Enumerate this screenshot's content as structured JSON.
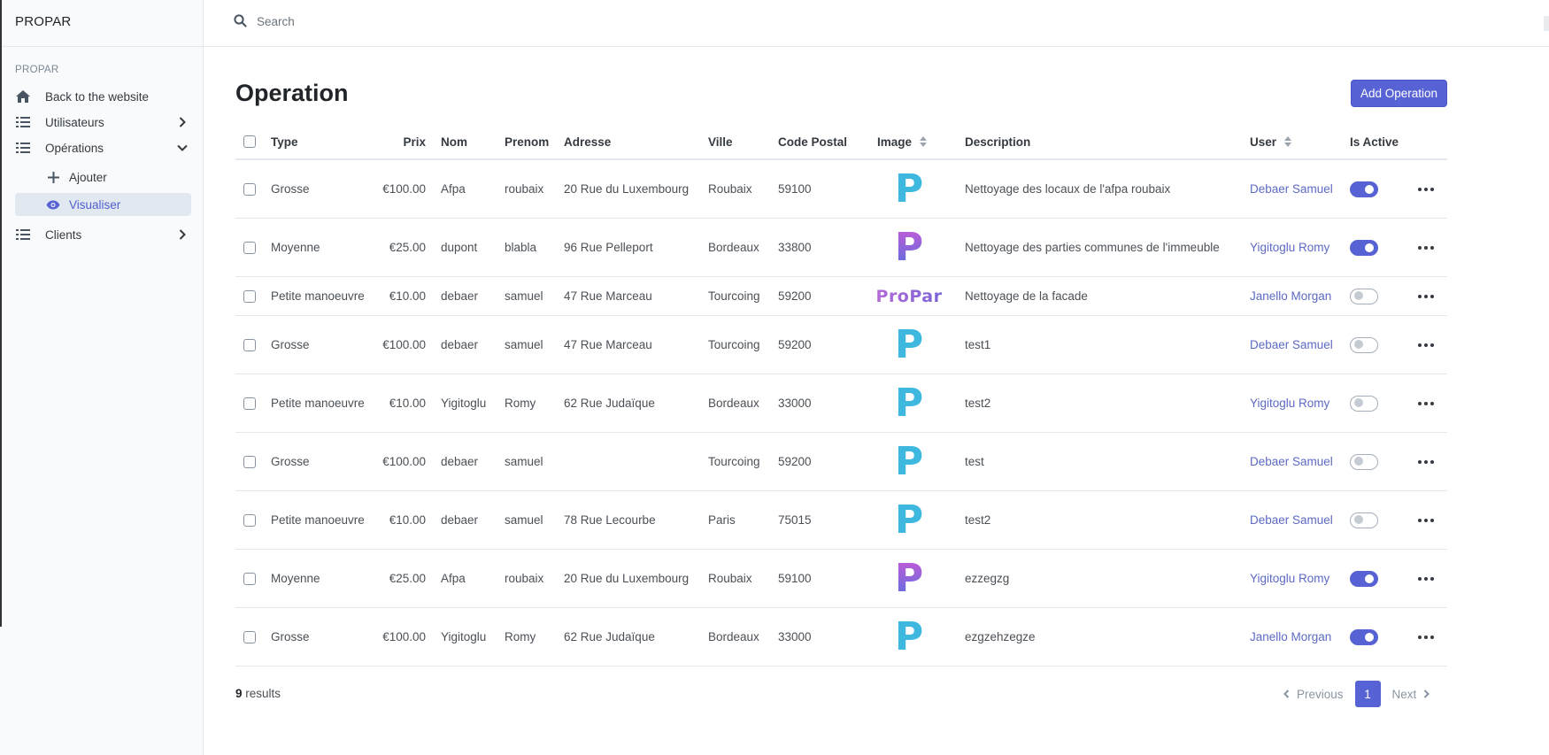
{
  "app": {
    "brand": "PROPAR"
  },
  "sidebar": {
    "section_label": "PROPAR",
    "items": [
      {
        "label": "Back to the website",
        "icon": "home-icon"
      },
      {
        "label": "Utilisateurs",
        "icon": "list-icon"
      },
      {
        "label": "Opérations",
        "icon": "list-icon",
        "expanded": true
      },
      {
        "label": "Clients",
        "icon": "list-icon"
      }
    ],
    "sub_items": [
      {
        "label": "Ajouter",
        "icon": "plus-icon"
      },
      {
        "label": "Visualiser",
        "icon": "eye-icon",
        "active": true
      }
    ]
  },
  "search": {
    "placeholder": "Search",
    "value": ""
  },
  "page": {
    "title": "Operation",
    "add_button": "Add Operation"
  },
  "table": {
    "headers": {
      "type": "Type",
      "prix": "Prix",
      "nom": "Nom",
      "prenom": "Prenom",
      "adresse": "Adresse",
      "ville": "Ville",
      "code_postal": "Code Postal",
      "image": "Image",
      "description": "Description",
      "user": "User",
      "is_active": "Is Active"
    },
    "rows": [
      {
        "type": "Grosse",
        "prix": "€100.00",
        "nom": "Afpa",
        "prenom": "roubaix",
        "adresse": "20 Rue du Luxembourg",
        "ville": "Roubaix",
        "code_postal": "59100",
        "image": "P",
        "image_style": "cyan",
        "description": "Nettoyage des locaux de l'afpa roubaix",
        "user": "Debaer Samuel",
        "active": true
      },
      {
        "type": "Moyenne",
        "prix": "€25.00",
        "nom": "dupont",
        "prenom": "blabla",
        "adresse": "96 Rue Pelleport",
        "ville": "Bordeaux",
        "code_postal": "33800",
        "image": "P",
        "image_style": "gradient",
        "description": "Nettoyage des parties communes de l'immeuble",
        "user": "Yigitoglu Romy",
        "active": true
      },
      {
        "type": "Petite manoeuvre",
        "prix": "€10.00",
        "nom": "debaer",
        "prenom": "samuel",
        "adresse": "47 Rue Marceau",
        "ville": "Tourcoing",
        "code_postal": "59200",
        "image": "ProPar",
        "image_style": "word",
        "description": "Nettoyage de la facade",
        "user": "Janello Morgan",
        "active": false
      },
      {
        "type": "Grosse",
        "prix": "€100.00",
        "nom": "debaer",
        "prenom": "samuel",
        "adresse": "47 Rue Marceau",
        "ville": "Tourcoing",
        "code_postal": "59200",
        "image": "P",
        "image_style": "cyan",
        "description": "test1",
        "user": "Debaer Samuel",
        "active": false
      },
      {
        "type": "Petite manoeuvre",
        "prix": "€10.00",
        "nom": "Yigitoglu",
        "prenom": "Romy",
        "adresse": "62 Rue Judaïque",
        "ville": "Bordeaux",
        "code_postal": "33000",
        "image": "P",
        "image_style": "cyan",
        "description": "test2",
        "user": "Yigitoglu Romy",
        "active": false
      },
      {
        "type": "Grosse",
        "prix": "€100.00",
        "nom": "debaer",
        "prenom": "samuel",
        "adresse": "",
        "ville": "Tourcoing",
        "code_postal": "59200",
        "image": "P",
        "image_style": "cyan",
        "description": "test",
        "user": "Debaer Samuel",
        "active": false
      },
      {
        "type": "Petite manoeuvre",
        "prix": "€10.00",
        "nom": "debaer",
        "prenom": "samuel",
        "adresse": "78 Rue Lecourbe",
        "ville": "Paris",
        "code_postal": "75015",
        "image": "P",
        "image_style": "cyan",
        "description": "test2",
        "user": "Debaer Samuel",
        "active": false
      },
      {
        "type": "Moyenne",
        "prix": "€25.00",
        "nom": "Afpa",
        "prenom": "roubaix",
        "adresse": "20 Rue du Luxembourg",
        "ville": "Roubaix",
        "code_postal": "59100",
        "image": "P",
        "image_style": "gradient",
        "description": "ezzegzg",
        "user": "Yigitoglu Romy",
        "active": true
      },
      {
        "type": "Grosse",
        "prix": "€100.00",
        "nom": "Yigitoglu",
        "prenom": "Romy",
        "adresse": "62 Rue Judaïque",
        "ville": "Bordeaux",
        "code_postal": "33000",
        "image": "P",
        "image_style": "cyan",
        "description": "ezgzehzegze",
        "user": "Janello Morgan",
        "active": true
      }
    ]
  },
  "footer": {
    "results_count": "9",
    "results_label": "results",
    "pagination": {
      "previous": "Previous",
      "current": "1",
      "next": "Next"
    }
  },
  "colors": {
    "accent": "#5762d5",
    "link": "#5c6ac4",
    "logo_cyan": "#3fb8e0",
    "logo_gradient_start": "#c25bd6",
    "logo_gradient_end": "#5b6fe0"
  }
}
